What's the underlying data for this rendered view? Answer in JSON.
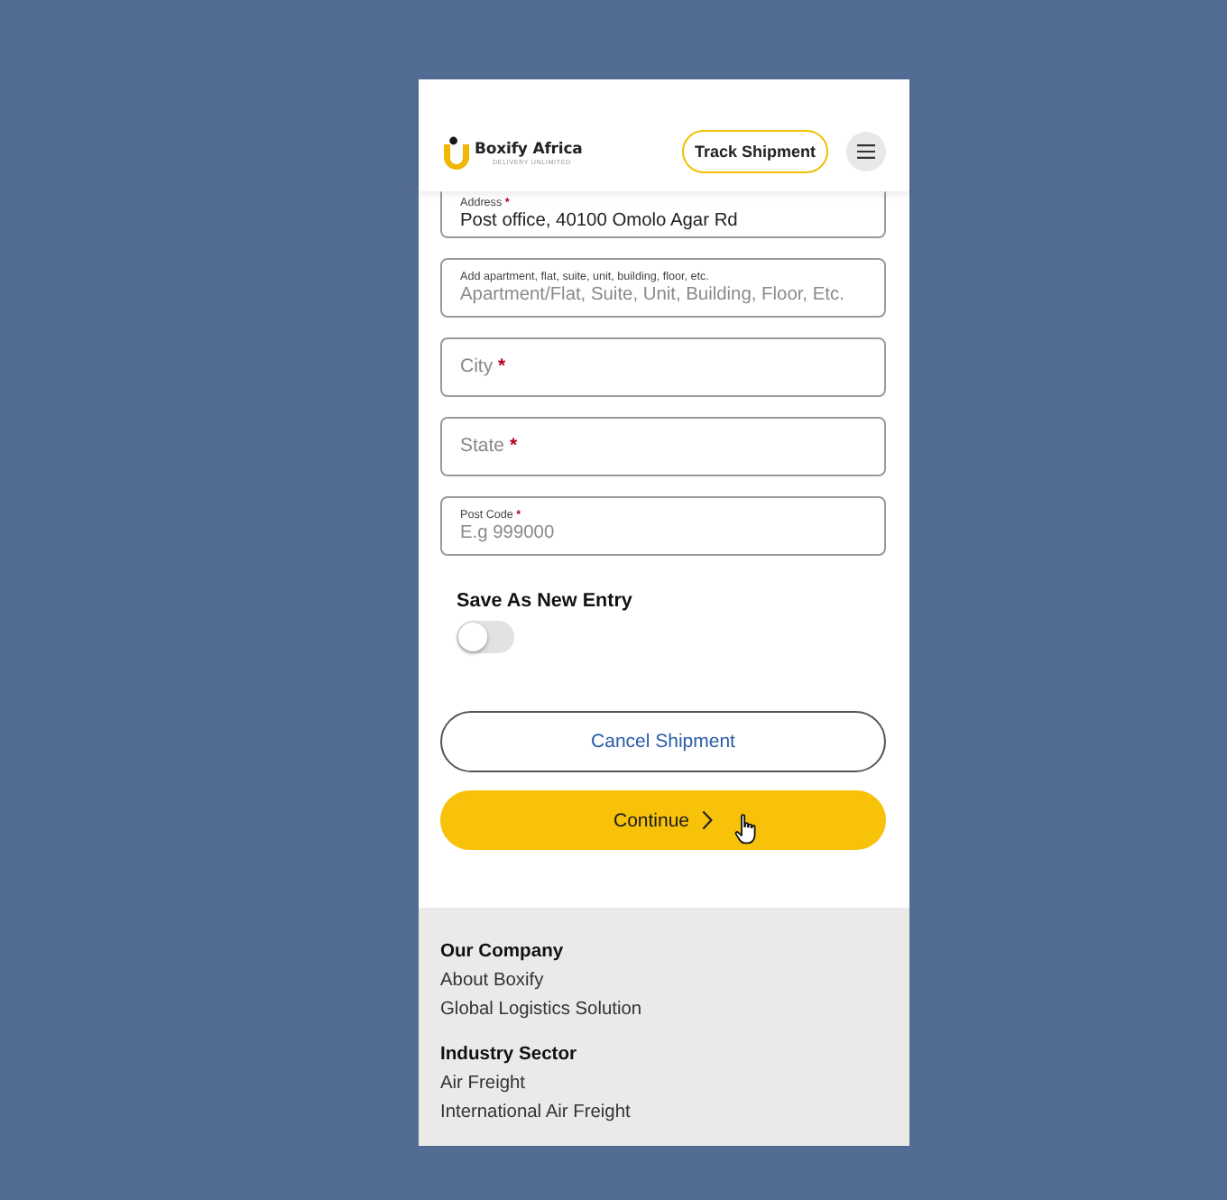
{
  "header": {
    "logo": {
      "name": "Boxify Africa",
      "tagline": "DELIVERY UNLIMITED"
    },
    "track_button": "Track Shipment"
  },
  "form": {
    "fields": [
      {
        "kind": "filled",
        "label": "Address",
        "required_mark": "*",
        "value": "Post office, 40100 Omolo Agar Rd"
      },
      {
        "kind": "hint",
        "label": "Add apartment, flat, suite, unit, building, floor, etc.",
        "placeholder": "Apartment/Flat, Suite, Unit, Building, Floor, Etc."
      },
      {
        "kind": "inline",
        "label": "City",
        "required_mark": "*"
      },
      {
        "kind": "inline",
        "label": "State",
        "required_mark": "*"
      },
      {
        "kind": "hint",
        "label": "Post Code",
        "required_mark": "*",
        "placeholder": "E.g 999000"
      }
    ],
    "save_entry": {
      "label": "Save As New Entry",
      "on": false
    },
    "buttons": [
      {
        "kind": "outline",
        "label": "Cancel Shipment"
      },
      {
        "kind": "primary",
        "label": "Continue"
      }
    ]
  },
  "footer": {
    "sections": [
      {
        "heading": "Our Company",
        "links": [
          "About Boxify",
          "Global Logistics Solution"
        ]
      },
      {
        "heading": "Industry Sector",
        "links": [
          "Air Freight",
          "International Air Freight"
        ]
      }
    ]
  }
}
